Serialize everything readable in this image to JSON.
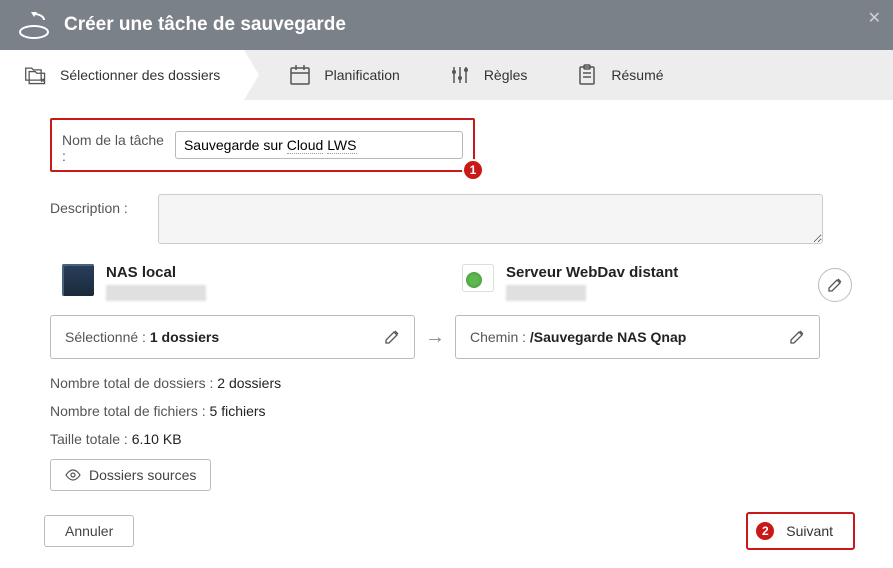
{
  "header": {
    "title": "Créer une tâche de sauvegarde"
  },
  "tabs": {
    "select": "Sélectionner des dossiers",
    "schedule": "Planification",
    "rules": "Règles",
    "summary": "Résumé"
  },
  "form": {
    "task_name_label": "Nom de la tâche :",
    "task_name_prefix": "Sauvegarde sur ",
    "task_name_w1": "Cloud",
    "task_name_w2": "LWS",
    "description_label": "Description :"
  },
  "badges": {
    "one": "1",
    "two": "2"
  },
  "source": {
    "nas_title": "NAS local",
    "webdav_title": "Serveur WebDav distant",
    "selected_label": "Sélectionné : ",
    "selected_value": "1 dossiers",
    "path_label": "Chemin : ",
    "path_value": "/Sauvegarde NAS Qnap"
  },
  "stats": {
    "folders_label": "Nombre total de dossiers : ",
    "folders_value": "2 dossiers",
    "files_label": "Nombre total de fichiers : ",
    "files_value": "5 fichiers",
    "size_label": "Taille totale : ",
    "size_value": "6.10 KB",
    "sources_btn": "Dossiers sources"
  },
  "footer": {
    "cancel": "Annuler",
    "next": "Suivant"
  }
}
